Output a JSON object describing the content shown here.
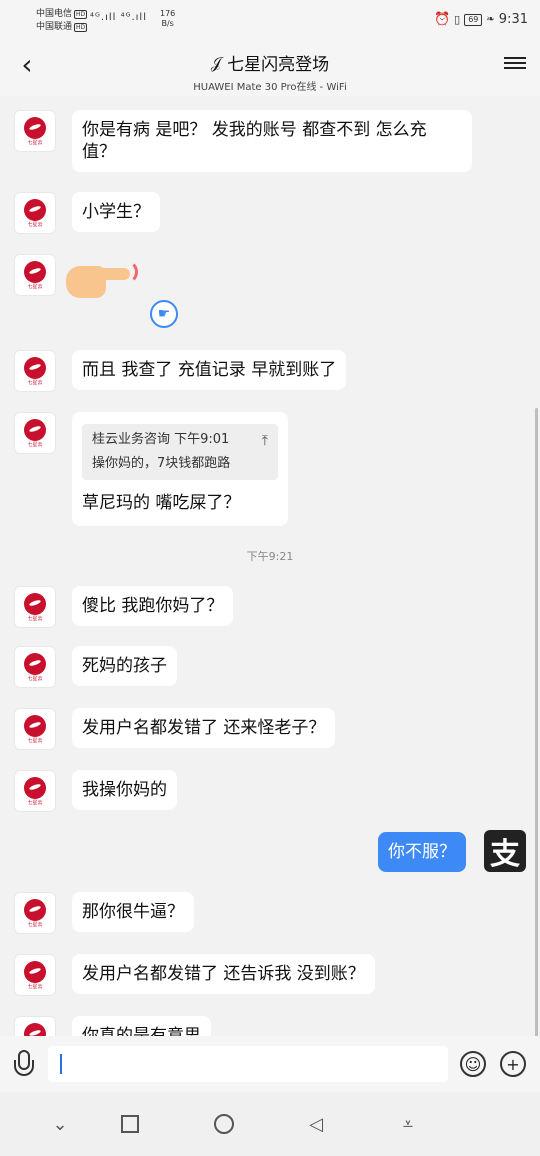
{
  "status_bar": {
    "carrier1": "中国电信",
    "carrier2": "中国联通",
    "hd": "HD",
    "signal": "⁴ᴳ.ıll ⁴ᴳ.ıll",
    "net_speed": "176",
    "net_unit": "B/s",
    "battery": "69",
    "time": "9:31"
  },
  "header": {
    "title": "七星闪亮登场",
    "subtitle": "HUAWEI Mate 30 Pro在线 - WiFi"
  },
  "messages": [
    {
      "text_line1": "你是有病 是吧？ 发我的账号 都查不到 怎么充",
      "text_line2": "值？"
    },
    {
      "text": "小学生？"
    },
    {
      "text": "而且 我查了 充值记录 早就到账了"
    },
    {
      "quote_header": "桂云业务咨询  下午9:01",
      "quote_body": "操你妈的，7块钱都跑路",
      "text": "草尼玛的 嘴吃屎了？"
    },
    {
      "timestamp": "下午9:21"
    },
    {
      "text": "傻比 我跑你妈了？"
    },
    {
      "text": "死妈的孩子"
    },
    {
      "text": "发用户名都发错了 还来怪老子？"
    },
    {
      "text": "我操你妈的"
    },
    {
      "text": "你不服？",
      "me": true
    },
    {
      "text": "那你很牛逼？"
    },
    {
      "text": "发用户名都发错了 还告诉我 没到账？"
    },
    {
      "text": "你真的是有意思"
    }
  ],
  "avatar_mark": "七星云",
  "alipay_glyph": "支",
  "input": {
    "placeholder": ""
  },
  "colors": {
    "bubble_me": "#3d8af7",
    "bubble_other": "#ffffff",
    "avatar_red": "#c8102e"
  }
}
